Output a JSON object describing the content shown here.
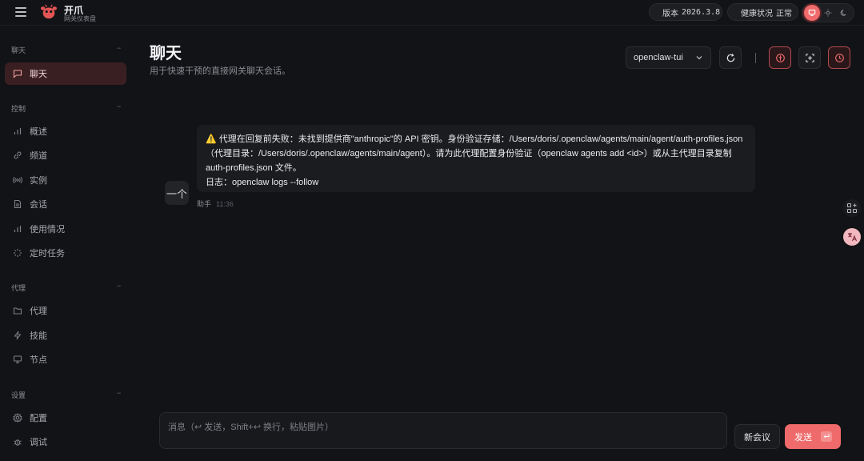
{
  "app": {
    "brand_name": "开爪",
    "brand_subtitle": "网关仪表盘",
    "version_label": "版本",
    "version_value": "2026.3.8",
    "health_label": "健康状况",
    "health_value": "正常",
    "status_color": "#22c55e",
    "accent_color": "#ef6b6b"
  },
  "sidebar": {
    "sections": [
      {
        "title": "聊天",
        "items": [
          {
            "label": "聊天",
            "icon": "chat-icon",
            "active": true
          }
        ]
      },
      {
        "title": "控制",
        "items": [
          {
            "label": "概述",
            "icon": "bar-chart-icon"
          },
          {
            "label": "频道",
            "icon": "link-icon"
          },
          {
            "label": "实例",
            "icon": "broadcast-icon"
          },
          {
            "label": "会话",
            "icon": "document-icon"
          },
          {
            "label": "使用情况",
            "icon": "bar-chart-icon"
          },
          {
            "label": "定时任务",
            "icon": "loader-icon"
          }
        ]
      },
      {
        "title": "代理",
        "items": [
          {
            "label": "代理",
            "icon": "folder-icon"
          },
          {
            "label": "技能",
            "icon": "lightning-icon"
          },
          {
            "label": "节点",
            "icon": "monitor-icon"
          }
        ]
      },
      {
        "title": "设置",
        "items": [
          {
            "label": "配置",
            "icon": "gear-icon"
          },
          {
            "label": "调试",
            "icon": "bug-icon"
          }
        ]
      }
    ]
  },
  "main": {
    "title": "聊天",
    "subtitle": "用于快速干预的直接网关聊天会话。",
    "session_value": "openclaw-tui"
  },
  "message": {
    "avatar_text": "一个",
    "lines": [
      "⚠️ 代理在回复前失败：未找到提供商\"anthropic\"的 API 密钥。身份验证存储：/Users/doris/.openclaw/agents/main/agent/auth-profiles.json",
      "（代理目录：/Users/doris/.openclaw/agents/main/agent）。请为此代理配置身份验证（openclaw agents add <id>）或从主代理目录复制",
      "auth-profiles.json 文件。",
      "日志：openclaw logs --follow"
    ],
    "sender": "助手",
    "time": "11:36"
  },
  "composer": {
    "placeholder": "消息（↩ 发送，Shift+↩ 换行，粘贴图片）",
    "new_session_label": "新会议",
    "send_label": "发送"
  }
}
